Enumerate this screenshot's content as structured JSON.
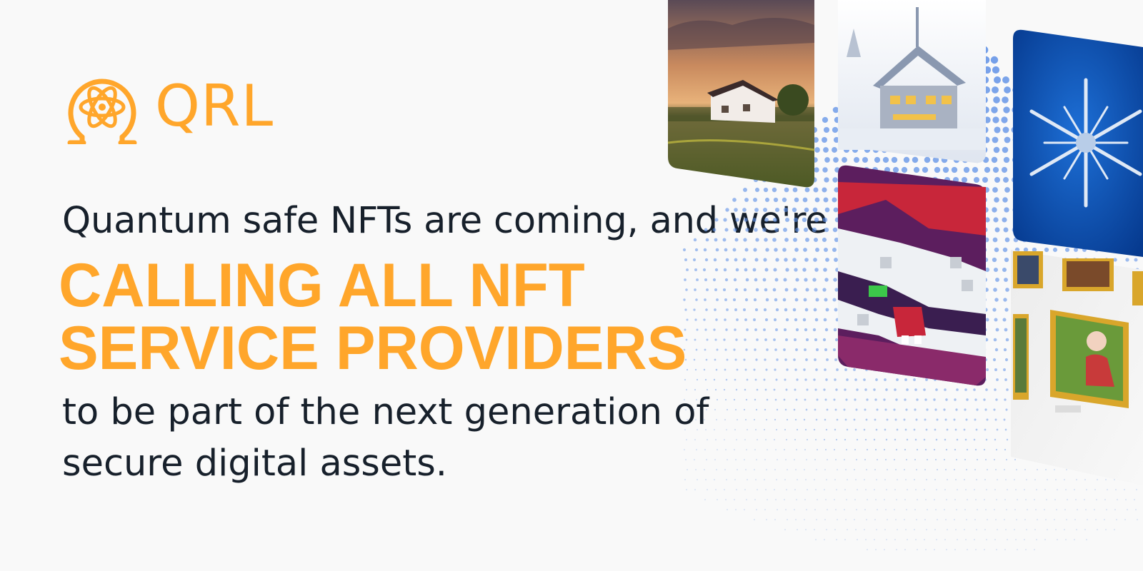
{
  "brand": {
    "name": "QRL",
    "logo_icon": "atom-omega-icon",
    "color": "#ffa62b"
  },
  "intro": "Quantum safe NFTs are coming, and we're",
  "headline": [
    "CALLING ALL NFT",
    "SERVICE PROVIDERS"
  ],
  "outro": [
    "to be part of the next generation of",
    "secure digital assets."
  ],
  "colors": {
    "accent": "#ffa62b",
    "text": "#17202b",
    "dots": "#5b8ee6",
    "background": "#f9f9f9"
  },
  "artwork": [
    {
      "name": "sunset-house-card"
    },
    {
      "name": "snowy-house-card"
    },
    {
      "name": "snowflake-card"
    },
    {
      "name": "pixel-cat-card"
    },
    {
      "name": "gallery-wall"
    }
  ]
}
